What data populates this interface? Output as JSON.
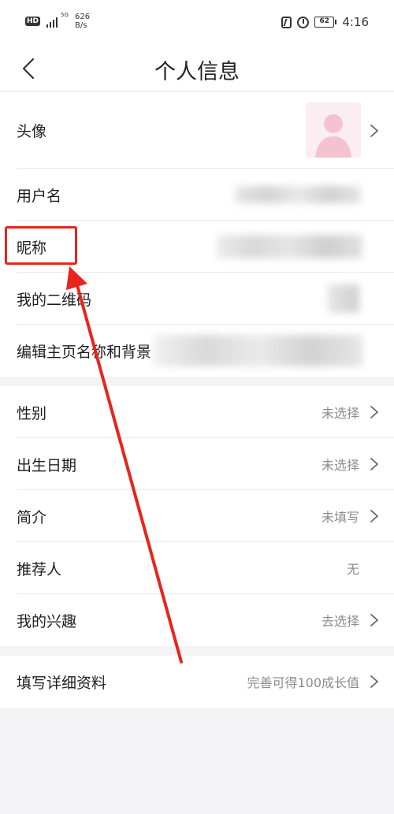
{
  "status_bar": {
    "hd": "HD",
    "network": "5G",
    "speed_value": "626",
    "speed_unit": "B/s",
    "battery": "62",
    "time": "4:16"
  },
  "header": {
    "title": "个人信息",
    "back_icon": "chevron-left-icon"
  },
  "profile": {
    "avatar_label": "头像",
    "username_label": "用户名",
    "nickname_label": "昵称",
    "qrcode_label": "我的二维码",
    "homepage_label": "编辑主页名称和背景"
  },
  "details": {
    "gender_label": "性别",
    "gender_value": "未选择",
    "birthday_label": "出生日期",
    "birthday_value": "未选择",
    "intro_label": "简介",
    "intro_value": "未填写",
    "referrer_label": "推荐人",
    "referrer_value": "无",
    "interests_label": "我的兴趣",
    "interests_value": "去选择"
  },
  "extra": {
    "fill_details_label": "填写详细资料",
    "fill_details_value": "完善可得100成长值"
  },
  "colors": {
    "annotation": "#e7251d",
    "background": "#f4f4f6",
    "value_text": "#8c8c8c"
  }
}
